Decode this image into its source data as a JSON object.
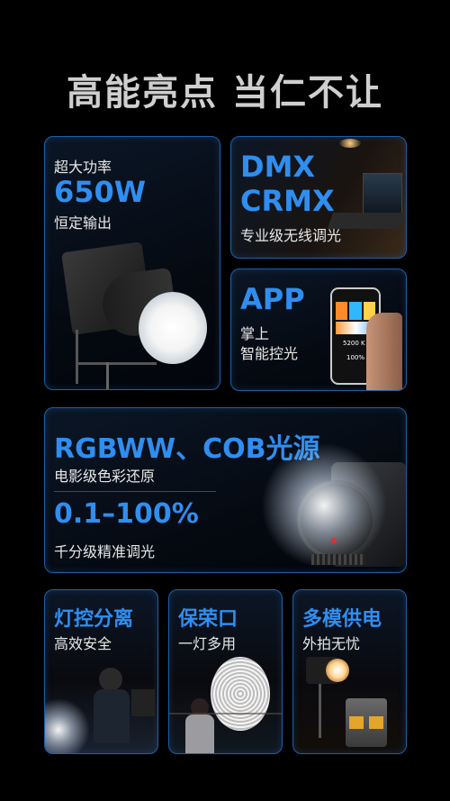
{
  "header": {
    "title": "高能亮点 当仁不让"
  },
  "card_power": {
    "line1": "超大功率",
    "big": "650W",
    "line2": "恒定输出"
  },
  "card_dmx": {
    "line1": "DMX",
    "line2": "CRMX",
    "sub": "专业级无线调光"
  },
  "card_app": {
    "big": "APP",
    "line1": "掌上",
    "line2": "智能控光",
    "phone_readout": "5200 K",
    "phone_percent": "100%"
  },
  "card_rgb": {
    "big": "RGBWW、COB光源",
    "sub1": "电影级色彩还原",
    "big2": "0.1–100%",
    "sub2": "千分级精准调光"
  },
  "card_light_control": {
    "title": "灯控分离",
    "sub": "高效安全"
  },
  "card_bowens": {
    "title": "保荣口",
    "sub": "一灯多用"
  },
  "card_power_supply": {
    "title": "多模供电",
    "sub": "外拍无忧"
  },
  "colors": {
    "accent": "#2f8ef0",
    "border": "#1f5fa8",
    "background": "#000000"
  }
}
